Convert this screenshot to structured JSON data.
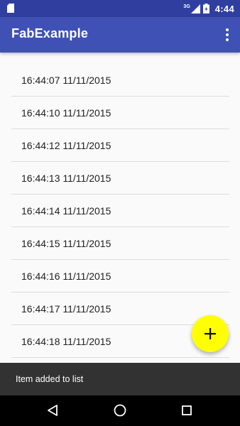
{
  "status_bar": {
    "network_label": "3G",
    "time": "4:44",
    "icons": [
      "sd-card-icon",
      "signal-icon",
      "battery-icon"
    ]
  },
  "app_bar": {
    "title": "FabExample",
    "menu_icon": "overflow-menu-icon",
    "color": "#3f51b5"
  },
  "list": {
    "items": [
      "16:44:07 11/11/2015",
      "16:44:10 11/11/2015",
      "16:44:12 11/11/2015",
      "16:44:13 11/11/2015",
      "16:44:14 11/11/2015",
      "16:44:15 11/11/2015",
      "16:44:16 11/11/2015",
      "16:44:17 11/11/2015",
      "16:44:18 11/11/2015"
    ]
  },
  "fab": {
    "icon": "add-icon",
    "color": "#ffff00"
  },
  "snackbar": {
    "message": "Item added to list"
  },
  "nav_bar": {
    "buttons": [
      "back-icon",
      "home-icon",
      "recents-icon"
    ]
  }
}
